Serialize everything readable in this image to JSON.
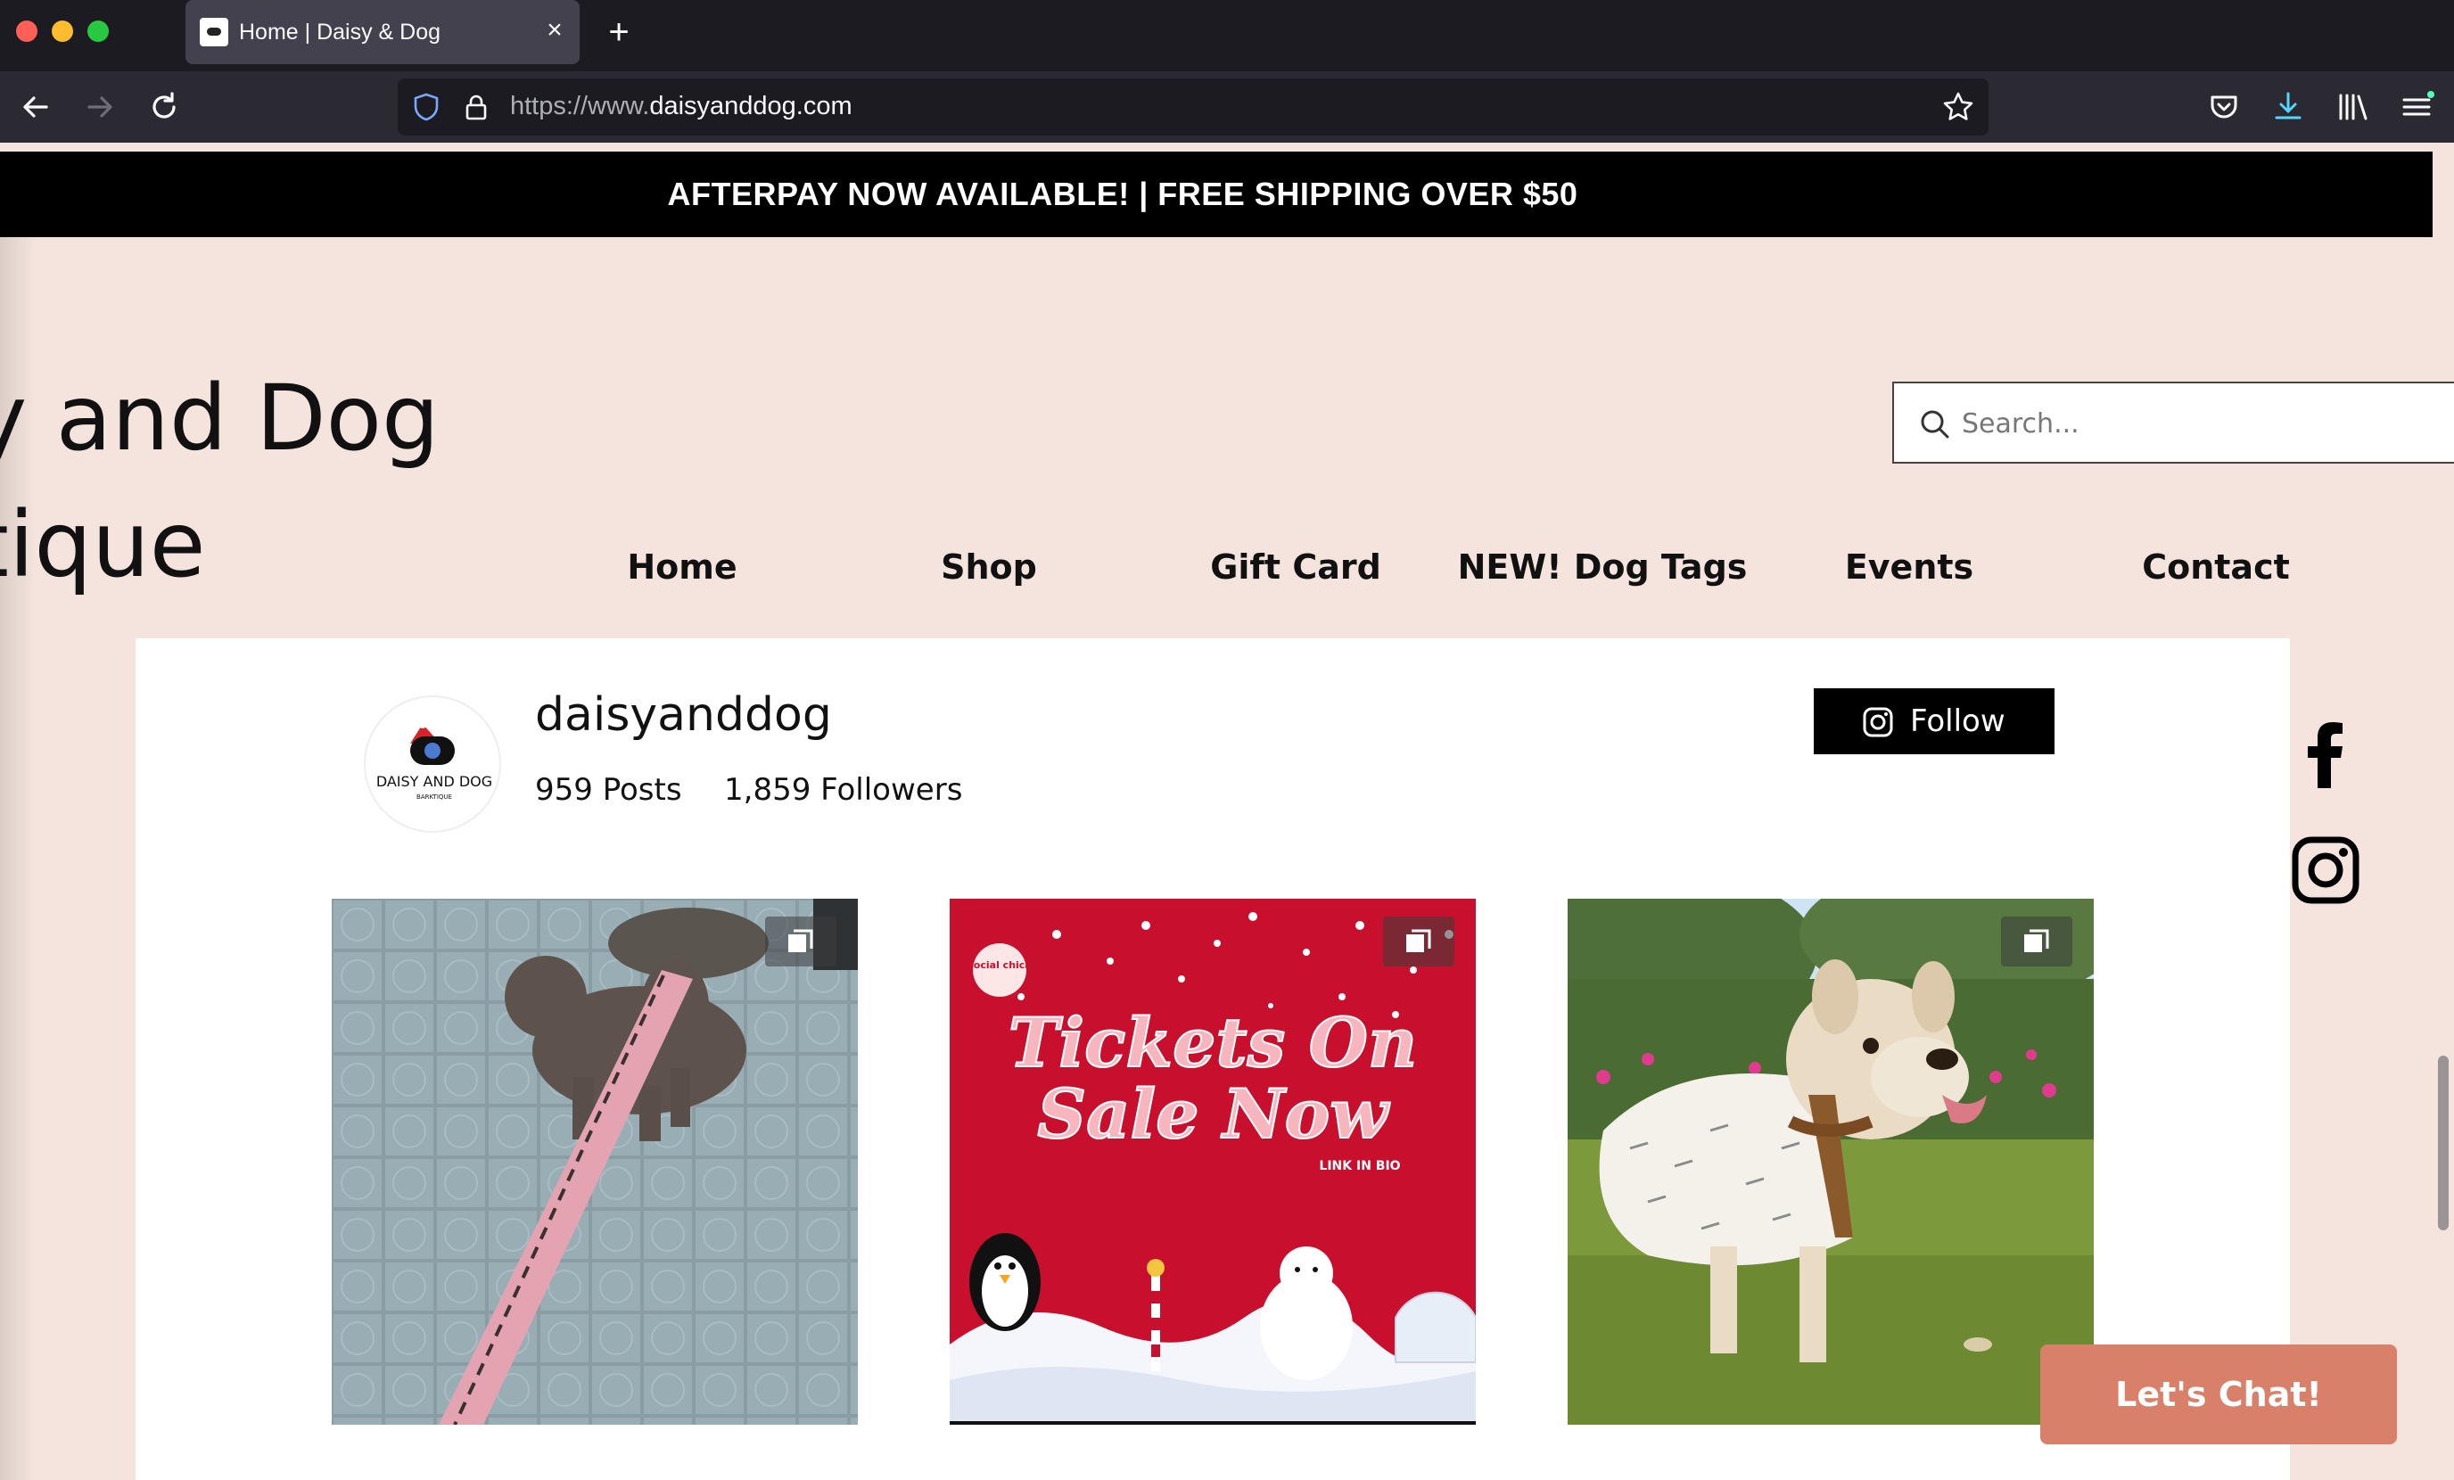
{
  "browser": {
    "tab_title": "Home | Daisy & Dog",
    "url_prefix": "https://www.",
    "url_domain": "daisyanddog.com",
    "icons": [
      "back-icon",
      "forward-icon",
      "reload-icon",
      "shield-icon",
      "lock-icon",
      "star-icon",
      "pocket-icon",
      "download-icon",
      "library-icon",
      "menu-icon"
    ]
  },
  "banner": {
    "text": "AFTERPAY NOW AVAILABLE! | FREE SHIPPING OVER $50"
  },
  "brand": {
    "line1": "y and Dog",
    "line2": "tique"
  },
  "search": {
    "placeholder": "Search..."
  },
  "nav": {
    "items": [
      "Home",
      "Shop",
      "Gift Card",
      "NEW! Dog Tags",
      "Events",
      "Contact"
    ]
  },
  "instagram": {
    "username": "daisyanddog",
    "posts": "959 Posts",
    "followers": "1,859 Followers",
    "follow_label": "Follow",
    "avatar_text": "DAISY AND DOG",
    "avatar_subtext": "BARKTIQUE",
    "post2_badge": "social chica",
    "post2_line1": "Tickets On",
    "post2_line2": "Sale Now",
    "post2_caption": "LINK IN BIO"
  },
  "chat": {
    "label": "Let's Chat!"
  },
  "colors": {
    "page_bg": "#f5e4de",
    "banner_bg": "#000000",
    "chat_bg": "#d9806a",
    "post_red": "#c8102e"
  }
}
